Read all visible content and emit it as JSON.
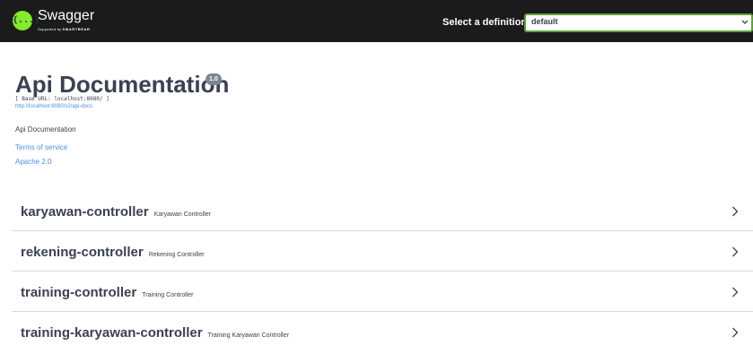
{
  "topbar": {
    "brand": "Swagger",
    "brand_tagline_prefix": "Supported by",
    "brand_tagline_company": "SMARTBEAR",
    "definition_label": "Select a definition",
    "definition_value": "default",
    "logo_glyph": "{...}"
  },
  "info": {
    "title": "Api Documentation",
    "version": "1.0",
    "base_url": "[ Base URL: localhost:8080/ ]",
    "docs_url": "http://localhost:8080/v2/api-docs",
    "description": "Api Documentation",
    "terms_label": "Terms of service",
    "license_label": "Apache 2.0"
  },
  "tags": [
    {
      "name": "karyawan-controller",
      "description": "Karyawan Controller"
    },
    {
      "name": "rekening-controller",
      "description": "Rekening Controller"
    },
    {
      "name": "training-controller",
      "description": "Training Controller"
    },
    {
      "name": "training-karyawan-controller",
      "description": "Training Karyawan Controller"
    }
  ],
  "colors": {
    "topbar_bg": "#1b1b1b",
    "logo_green": "#85ea2d",
    "select_border": "#62a03f",
    "link": "#4990e2",
    "text": "#3b4151",
    "badge": "#7d8492"
  },
  "icons": {
    "logo": "swagger-logo-icon",
    "select_arrow": "chevron-down-icon",
    "expand": "chevron-right-icon"
  }
}
